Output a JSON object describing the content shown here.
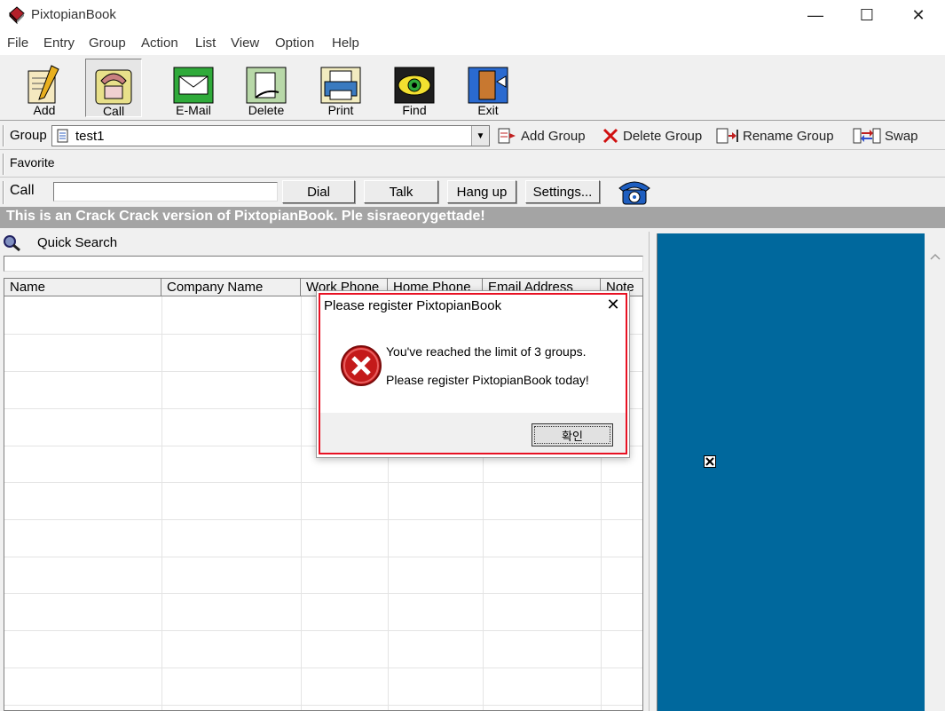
{
  "window": {
    "title": "PixtopianBook",
    "minimize_glyph": "—",
    "maximize_glyph": "☐",
    "close_glyph": "✕"
  },
  "menu": [
    "File",
    "Entry",
    "Group",
    "Action",
    "List",
    "View",
    "Option",
    "Help"
  ],
  "toolbar": {
    "add": "Add",
    "call": "Call",
    "email": "E-Mail",
    "delete": "Delete",
    "print": "Print",
    "find": "Find",
    "exit": "Exit"
  },
  "group_bar": {
    "label": "Group",
    "selected": "test1",
    "dropdown_glyph": "▼",
    "add_group": "Add Group",
    "delete_group": "Delete Group",
    "rename_group": "Rename Group",
    "swap": "Swap"
  },
  "favorite_bar": {
    "label": "Favorite"
  },
  "call_bar": {
    "label": "Call",
    "number_value": "",
    "dial": "Dial",
    "talk": "Talk",
    "hang_up": "Hang up",
    "settings": "Settings..."
  },
  "banner": "This is an Crack Crack  version of PixtopianBook. Ple sisraeorygettade!",
  "quick_search": {
    "label": "Quick Search",
    "value": ""
  },
  "grid": {
    "columns": [
      "Name",
      "Company Name",
      "Work Phone",
      "Home Phone",
      "Email Address",
      "Note"
    ],
    "rows": []
  },
  "dialog": {
    "title": "Please register PixtopianBook",
    "close_glyph": "✕",
    "message1": "You've reached the limit of 3 groups.",
    "message2": "Please register PixtopianBook today!",
    "ok": "확인"
  },
  "colors": {
    "right_pane": "#00689d",
    "banner": "#a4a4a4",
    "dialog_border": "#e81123"
  }
}
